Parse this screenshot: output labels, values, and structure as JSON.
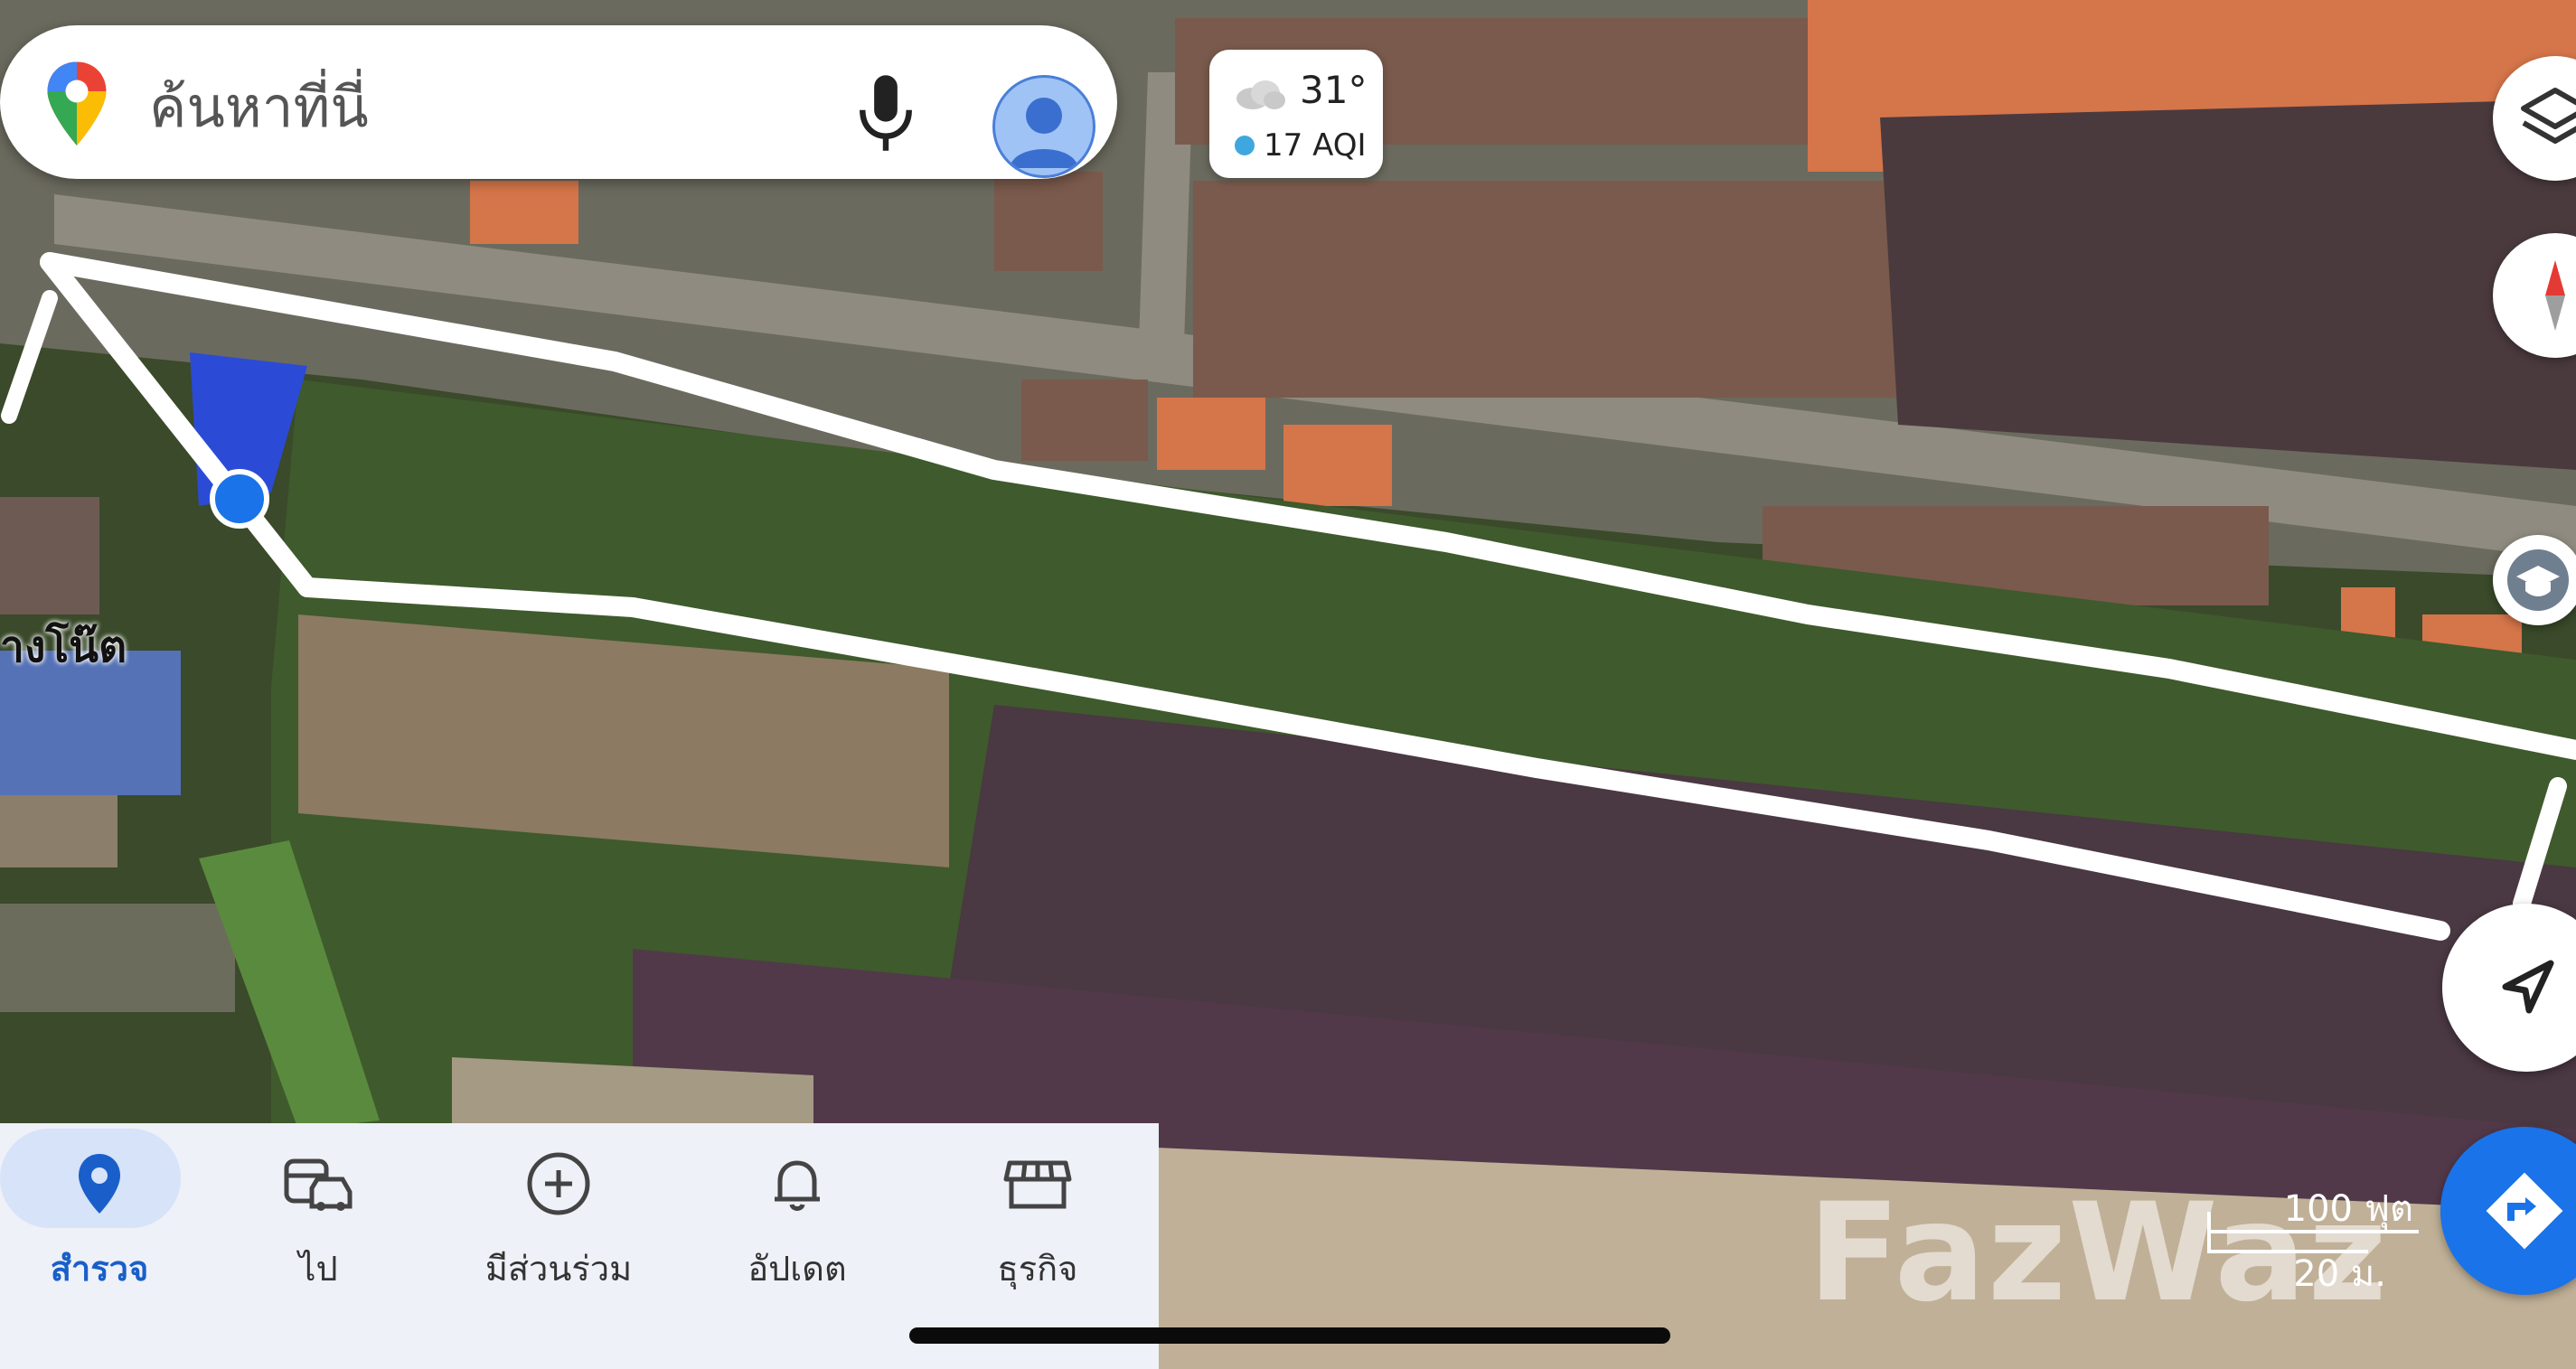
{
  "search": {
    "placeholder": "ค้นหาที่นี่"
  },
  "weather": {
    "temperature": "31°",
    "aqi": "17 AQI"
  },
  "map": {
    "place_label": "างโน๊ต",
    "scale_feet": "100 ฟุต",
    "scale_meters": "20 ม.",
    "watermark": "FazWaz"
  },
  "bottom_nav": [
    {
      "label": "สำรวจ",
      "icon": "location-pin-icon"
    },
    {
      "label": "ไป",
      "icon": "commute-icon"
    },
    {
      "label": "มีส่วนร่วม",
      "icon": "add-circle-icon"
    },
    {
      "label": "อัปเดต",
      "icon": "bell-icon"
    },
    {
      "label": "ธุรกิจ",
      "icon": "store-icon"
    }
  ],
  "colors": {
    "accent": "#1a73e8",
    "nav_bg": "#eef1f7",
    "outline": "#ffffff"
  }
}
